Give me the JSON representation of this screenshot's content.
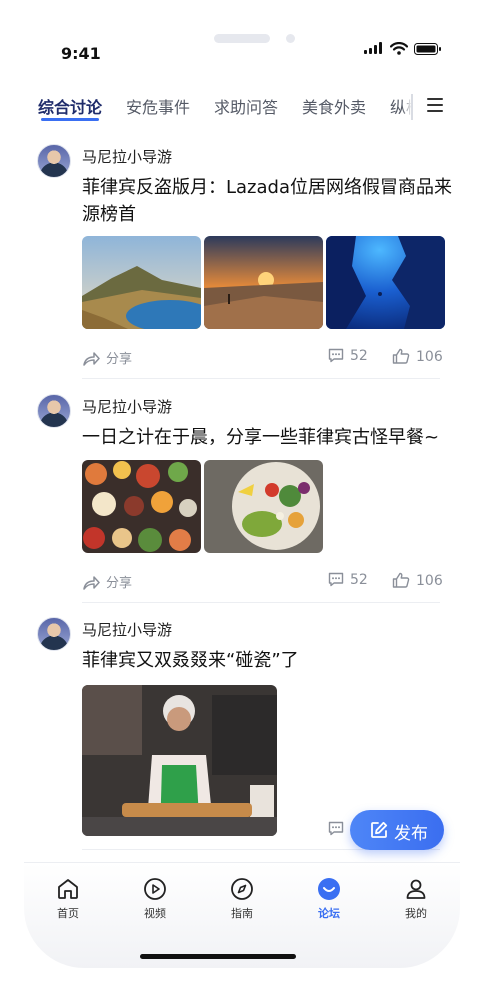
{
  "status_bar": {
    "time": "9:41"
  },
  "tabs": [
    {
      "label": "综合讨论",
      "active": true
    },
    {
      "label": "安危事件",
      "active": false
    },
    {
      "label": "求助问答",
      "active": false
    },
    {
      "label": "美食外卖",
      "active": false
    },
    {
      "label": "纵横",
      "active": false
    }
  ],
  "posts": [
    {
      "author": "马尼拉小导游",
      "title": "菲律宾反盗版月：Lazada位居网络假冒商品来源榜首",
      "share_label": "分享",
      "comments": "52",
      "likes": "106"
    },
    {
      "author": "马尼拉小导游",
      "title": "一日之计在于晨，分享一些菲律宾古怪早餐~",
      "share_label": "分享",
      "comments": "52",
      "likes": "106"
    },
    {
      "author": "马尼拉小导游",
      "title": "菲律宾又双叒叕来“碰瓷”了"
    }
  ],
  "fab": {
    "label": "发布"
  },
  "bottom_nav": [
    {
      "label": "首页",
      "icon": "home-icon",
      "active": false
    },
    {
      "label": "视频",
      "icon": "play-icon",
      "active": false
    },
    {
      "label": "指南",
      "icon": "compass-icon",
      "active": false
    },
    {
      "label": "论坛",
      "icon": "forum-icon",
      "active": true
    },
    {
      "label": "我的",
      "icon": "user-icon",
      "active": false
    }
  ],
  "colors": {
    "accent": "#3a6ff2",
    "active_tab_text": "#1f2c6b"
  }
}
